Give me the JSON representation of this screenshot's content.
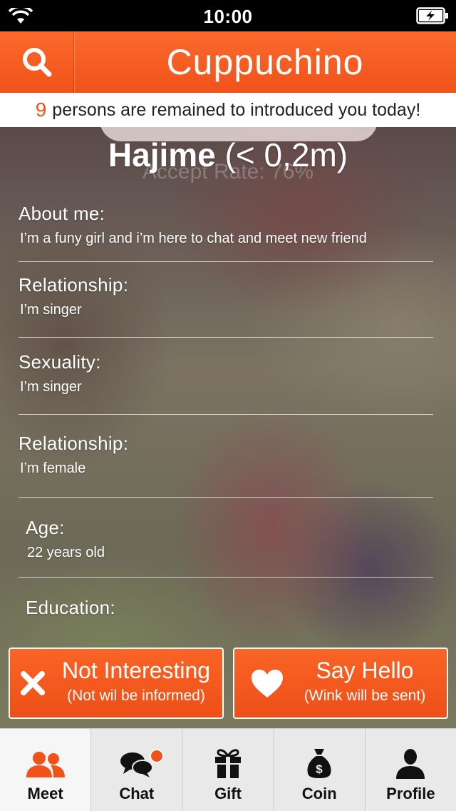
{
  "status_bar": {
    "time": "10:00"
  },
  "header": {
    "title": "Cuppuchino",
    "search_icon": "search-icon"
  },
  "banner": {
    "count": "9",
    "text": "persons are remained to introduced you today!"
  },
  "profile": {
    "name": "Hajime",
    "distance": "(< 0,2m)",
    "accept_rate": "Accept Rate: 76%"
  },
  "sections": [
    {
      "label": "About me:",
      "value": "I’m a funy girl and i’m here to chat and meet new friend"
    },
    {
      "label": "Relationship:",
      "value": "I’m singer"
    },
    {
      "label": "Sexuality:",
      "value": "I’m singer"
    },
    {
      "label": "Relationship:",
      "value": "I’m female"
    },
    {
      "label": "Age:",
      "value": "22 years old"
    },
    {
      "label": "Education:",
      "value": ""
    }
  ],
  "actions": {
    "not_interesting": {
      "title": "Not Interesting",
      "subtitle": "(Not wil be informed)",
      "icon": "close-icon"
    },
    "say_hello": {
      "title": "Say Hello",
      "subtitle": "(Wink will be sent)",
      "icon": "heart-icon"
    }
  },
  "tabs": [
    {
      "label": "Meet",
      "icon": "users-icon",
      "active": true
    },
    {
      "label": "Chat",
      "icon": "chat-bubbles-icon",
      "badge": true
    },
    {
      "label": "Gift",
      "icon": "gift-icon"
    },
    {
      "label": "Coin",
      "icon": "money-bag-icon"
    },
    {
      "label": "Profile",
      "icon": "person-icon"
    }
  ],
  "colors": {
    "accent": "#f0521a",
    "tab_bar": "#e9e9e9"
  }
}
